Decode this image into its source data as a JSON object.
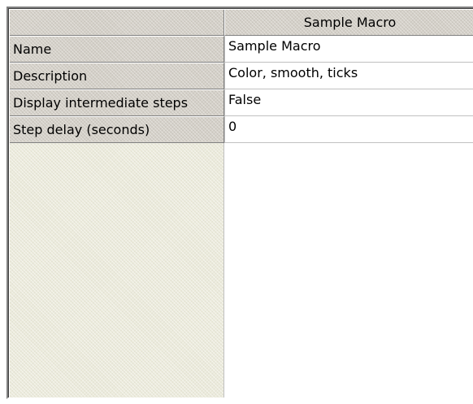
{
  "grid": {
    "header": {
      "corner_label": "",
      "column_title": "Sample Macro"
    },
    "rows": [
      {
        "label": "Name",
        "value": "Sample Macro"
      },
      {
        "label": "Description",
        "value": "Color, smooth, ticks"
      },
      {
        "label": "Display intermediate steps",
        "value": "False"
      },
      {
        "label": "Step delay (seconds)",
        "value": "0"
      }
    ]
  }
}
